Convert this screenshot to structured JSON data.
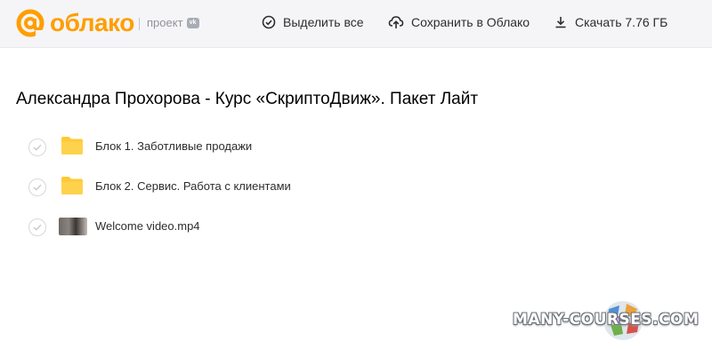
{
  "header": {
    "logo_text": "облако",
    "project_label": "проект",
    "vk_badge": "vk",
    "select_all_label": "Выделить все",
    "save_label": "Сохранить в Облако",
    "download_label": "Скачать 7.76 ГБ",
    "brand_color": "#ff9e00"
  },
  "main": {
    "title": "Александра Прохорова - Курс «СкриптоДвиж». Пакет Лайт",
    "files": [
      {
        "name": "Блок 1. Заботливые продажи",
        "type": "folder-icon"
      },
      {
        "name": "Блок 2. Сервис. Работа с клиентами",
        "type": "folder-icon"
      },
      {
        "name": "Welcome video.mp4",
        "type": "video-thumbnail"
      }
    ]
  },
  "watermark": {
    "text": "MANY-COURSES.COM"
  }
}
